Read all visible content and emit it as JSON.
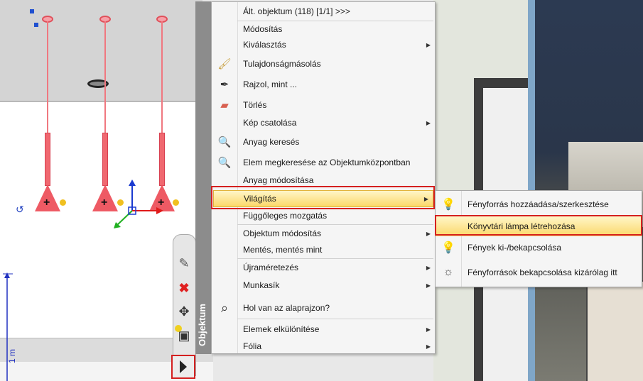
{
  "menu": {
    "strip_label": "Objektum",
    "items": [
      {
        "label": "Ált. objektum (118) [1/1] >>>",
        "icon": "",
        "submenu": false
      },
      {
        "label": "Módosítás",
        "icon": "",
        "submenu": false
      },
      {
        "label": "Kiválasztás",
        "icon": "",
        "submenu": true
      },
      {
        "label": "Tulajdonságmásolás",
        "icon": "brush-icon",
        "submenu": false
      },
      {
        "label": "Rajzol, mint ...",
        "icon": "eyedropper-icon",
        "submenu": false
      },
      {
        "label": "Törlés",
        "icon": "eraser-icon",
        "submenu": false
      },
      {
        "label": "Kép csatolása",
        "icon": "",
        "submenu": true
      },
      {
        "label": "Anyag keresés",
        "icon": "magnifier-plus-icon",
        "submenu": false
      },
      {
        "label": "Elem megkeresése az Objektumközpontban",
        "icon": "magnifier-plus-icon",
        "submenu": false
      },
      {
        "label": "Anyag módosítása",
        "icon": "",
        "submenu": false
      },
      {
        "label": "Világítás",
        "icon": "",
        "submenu": true,
        "highlighted": true
      },
      {
        "label": "Függőleges mozgatás",
        "icon": "",
        "submenu": false
      },
      {
        "label": "Objektum módosítás",
        "icon": "",
        "submenu": true
      },
      {
        "label": "Mentés, mentés mint",
        "icon": "",
        "submenu": false
      },
      {
        "label": "Újraméretezés",
        "icon": "",
        "submenu": true
      },
      {
        "label": "Munkasík",
        "icon": "",
        "submenu": true
      },
      {
        "label": "Hol van az alaprajzon?",
        "icon": "floorplan-search-icon",
        "submenu": false
      },
      {
        "label": "Elemek elkülönítése",
        "icon": "",
        "submenu": true
      },
      {
        "label": "Fólia",
        "icon": "",
        "submenu": true
      }
    ]
  },
  "submenu": {
    "items": [
      {
        "label": "Fényforrás hozzáadása/szerkesztése",
        "icon": "light-edit-icon"
      },
      {
        "label": "Könyvtári lámpa létrehozása",
        "icon": "",
        "highlighted": true
      },
      {
        "label": "Fények ki-/bekapcsolása",
        "icon": "bulb-cursor-icon"
      },
      {
        "label": "Fényforrások bekapcsolása kizárólag itt",
        "icon": "bulb-rays-icon"
      }
    ]
  },
  "viewport": {
    "axis_label": "1 m",
    "colors": {
      "lamp": "#ee5a64",
      "highlight_frame": "#d42020",
      "highlight_fill": "#fbd86a"
    }
  }
}
